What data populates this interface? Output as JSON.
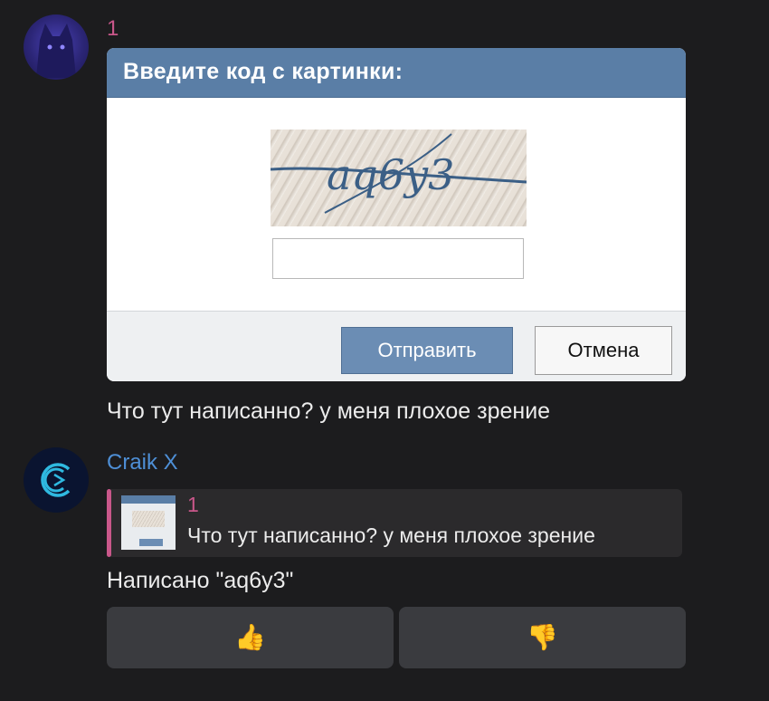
{
  "messages": [
    {
      "username": "1",
      "captcha": {
        "title": "Введите код с картинки:",
        "code": "aq6y3",
        "submit_label": "Отправить",
        "cancel_label": "Отмена"
      },
      "text": "Что тут написанно? у меня плохое зрение"
    },
    {
      "username": "Craik X",
      "reply": {
        "username": "1",
        "text": "Что тут написанно? у меня плохое зрение"
      },
      "text": "Написано \"aq6y3\""
    }
  ],
  "reactions": [
    {
      "icon": "thumbs-up-icon",
      "glyph": "👍"
    },
    {
      "icon": "thumbs-down-icon",
      "glyph": "👎"
    }
  ],
  "colors": {
    "background": "#1c1c1e",
    "username_1": "#c9578a",
    "username_2": "#4e8fd6",
    "captcha_header": "#5a7ea6"
  }
}
